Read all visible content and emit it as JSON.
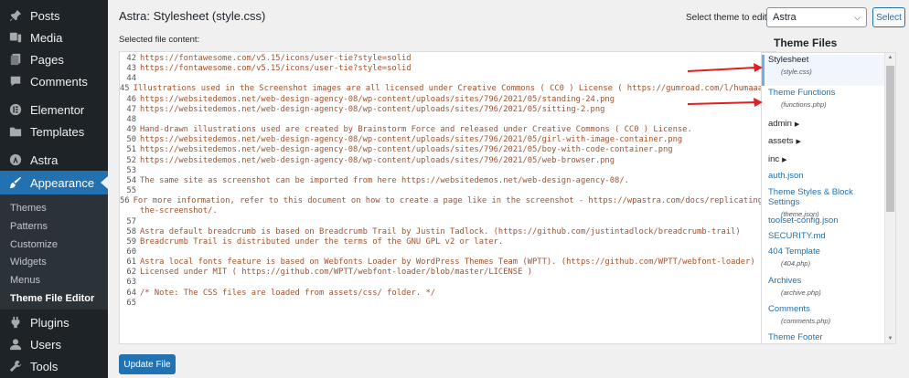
{
  "sidebar": {
    "items": [
      {
        "label": "Posts",
        "icon": "pin-icon"
      },
      {
        "label": "Media",
        "icon": "media-icon"
      },
      {
        "label": "Pages",
        "icon": "pages-icon"
      },
      {
        "label": "Comments",
        "icon": "comments-icon"
      },
      {
        "label": "Elementor",
        "icon": "elementor-icon"
      },
      {
        "label": "Templates",
        "icon": "folder-icon"
      },
      {
        "label": "Astra",
        "icon": "astra-icon"
      },
      {
        "label": "Appearance",
        "icon": "brush-icon"
      },
      {
        "label": "Plugins",
        "icon": "plugin-icon"
      },
      {
        "label": "Users",
        "icon": "users-icon"
      },
      {
        "label": "Tools",
        "icon": "wrench-icon"
      }
    ],
    "submenu": [
      "Themes",
      "Patterns",
      "Customize",
      "Widgets",
      "Menus",
      "Theme File Editor"
    ]
  },
  "header": {
    "title": "Astra: Stylesheet (style.css)",
    "selected_label": "Selected file content:",
    "theme_select_label": "Select theme to edit:",
    "theme_select_value": "Astra",
    "select_button": "Select"
  },
  "editor": {
    "lines": [
      {
        "n": "42",
        "t": "https://fontawesome.com/v5.15/icons/user-tie?style=solid"
      },
      {
        "n": "43",
        "t": "https://fontawesome.com/v5.15/icons/user-tie?style=solid"
      },
      {
        "n": "44",
        "t": ""
      },
      {
        "n": "45",
        "t": "Illustrations used in the Screenshot images are all licensed under Creative Commons ( CC0 ) License ( https://gumroad.com/l/humaaans )"
      },
      {
        "n": "46",
        "t": "https://websitedemos.net/web-design-agency-08/wp-content/uploads/sites/796/2021/05/standing-24.png"
      },
      {
        "n": "47",
        "t": "https://websitedemos.net/web-design-agency-08/wp-content/uploads/sites/796/2021/05/sitting-2.png"
      },
      {
        "n": "48",
        "t": ""
      },
      {
        "n": "49",
        "t": "Hand-drawn illustrations used are created by Brainstorm Force and released under Creative Commons ( CC0 ) License."
      },
      {
        "n": "50",
        "t": "https://websitedemos.net/web-design-agency-08/wp-content/uploads/sites/796/2021/05/girl-with-image-container.png"
      },
      {
        "n": "51",
        "t": "https://websitedemos.net/web-design-agency-08/wp-content/uploads/sites/796/2021/05/boy-with-code-container.png"
      },
      {
        "n": "52",
        "t": "https://websitedemos.net/web-design-agency-08/wp-content/uploads/sites/796/2021/05/web-browser.png"
      },
      {
        "n": "53",
        "t": ""
      },
      {
        "n": "54",
        "t": "The same site as screenshot can be imported from here https://websitedemos.net/web-design-agency-08/."
      },
      {
        "n": "55",
        "t": ""
      },
      {
        "n": "56",
        "t": "For more information, refer to this document on how to create a page like in the screenshot - https://wpastra.com/docs/replicating-"
      },
      {
        "n": "",
        "t": "the-screenshot/."
      },
      {
        "n": "57",
        "t": ""
      },
      {
        "n": "58",
        "t": "Astra default breadcrumb is based on Breadcrumb Trail by Justin Tadlock. (https://github.com/justintadlock/breadcrumb-trail)"
      },
      {
        "n": "59",
        "t": "Breadcrumb Trail is distributed under the terms of the GNU GPL v2 or later."
      },
      {
        "n": "60",
        "t": ""
      },
      {
        "n": "61",
        "t": "Astra local fonts feature is based on Webfonts Loader by WordPress Themes Team (WPTT). (https://github.com/WPTT/webfont-loader)"
      },
      {
        "n": "62",
        "t": "Licensed under MIT ( https://github.com/WPTT/webfont-loader/blob/master/LICENSE )"
      },
      {
        "n": "63",
        "t": ""
      },
      {
        "n": "64",
        "t": "/* Note: The CSS files are loaded from assets/css/ folder. */"
      },
      {
        "n": "65",
        "t": ""
      }
    ],
    "update_button": "Update File"
  },
  "files": {
    "heading": "Theme Files",
    "stylesheet": {
      "name": "Stylesheet",
      "sub": "(style.css)"
    },
    "functions": {
      "name": "Theme Functions",
      "sub": "(functions.php)"
    },
    "admin": "admin",
    "assets": "assets",
    "inc": "inc",
    "auth": "auth.json",
    "theme_json": {
      "name": "Theme Styles & Block Settings",
      "sub": "(theme.json)"
    },
    "toolset": "toolset-config.json",
    "security": "SECURITY.md",
    "template404": {
      "name": "404 Template",
      "sub": "(404.php)"
    },
    "archives": {
      "name": "Archives",
      "sub": "(archive.php)"
    },
    "comments": {
      "name": "Comments",
      "sub": "(comments.php)"
    },
    "footer": "Theme Footer"
  },
  "colors": {
    "accent": "#2271b1",
    "sidebar": "#1d2327",
    "annotation": "#e02020"
  }
}
